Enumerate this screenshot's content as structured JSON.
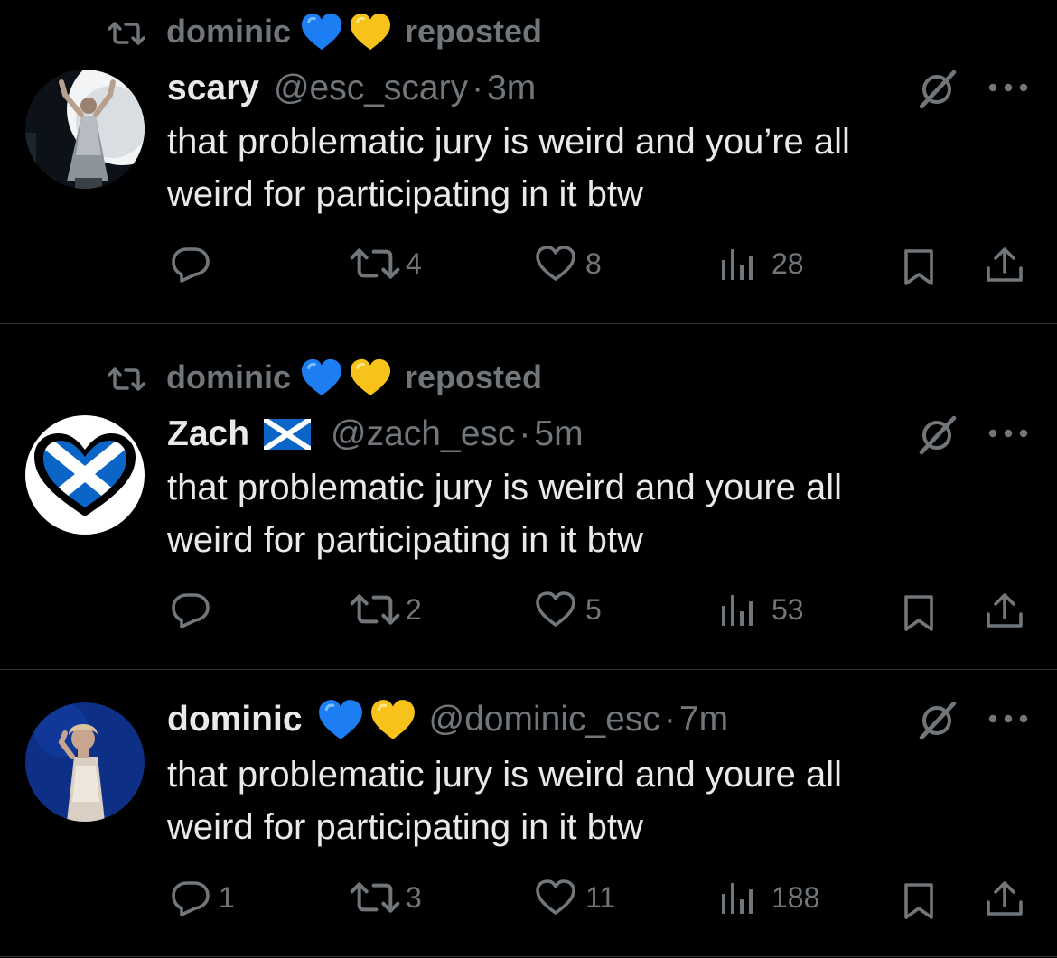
{
  "feed": {
    "tweets": [
      {
        "reposted_by": {
          "name": "dominic",
          "emojis": [
            "💙",
            "💛"
          ],
          "label": "reposted"
        },
        "author": {
          "name": "scary",
          "name_emojis": [],
          "handle": "@esc_scary",
          "separator": "·",
          "time": "3m",
          "avatar": "person-on-stage-avatar"
        },
        "text_lines": [
          "that problematic jury is weird and you’re all",
          "weird for participating in it btw"
        ],
        "stats": {
          "replies": "",
          "reposts": "4",
          "likes": "8",
          "views": "28"
        }
      },
      {
        "reposted_by": {
          "name": "dominic",
          "emojis": [
            "💙",
            "💛"
          ],
          "label": "reposted"
        },
        "author": {
          "name": "Zach",
          "name_emojis": [
            "scotland-flag"
          ],
          "handle": "@zach_esc",
          "separator": "·",
          "time": "5m",
          "avatar": "scottish-flag-heart-avatar"
        },
        "text_lines": [
          "that problematic jury is weird and youre all",
          "weird for participating in it btw"
        ],
        "stats": {
          "replies": "",
          "reposts": "2",
          "likes": "5",
          "views": "53"
        }
      },
      {
        "reposted_by": null,
        "author": {
          "name": "dominic",
          "name_emojis": [
            "💙",
            "💛"
          ],
          "handle": "@dominic_esc",
          "separator": "·",
          "time": "7m",
          "avatar": "person-portrait-avatar"
        },
        "text_lines": [
          "that problematic jury is weird and youre all",
          "weird for participating in it btw"
        ],
        "stats": {
          "replies": "1",
          "reposts": "3",
          "likes": "11",
          "views": "188"
        }
      }
    ]
  },
  "colors": {
    "background": "#000000",
    "text_primary": "#e7e9ea",
    "text_secondary": "#71767b",
    "divider": "#2f3336",
    "heart_blue": "#1d7df2",
    "heart_yellow": "#f7c21a",
    "scotland_blue": "#0b65c6"
  },
  "icons": [
    "repost-icon",
    "reply-icon",
    "like-icon",
    "views-icon",
    "bookmark-icon",
    "share-icon",
    "grok-icon",
    "more-icon"
  ]
}
